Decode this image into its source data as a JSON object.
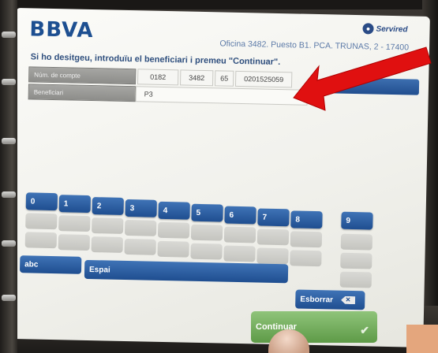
{
  "header": {
    "logo": "BBVA",
    "network": "Servired",
    "office": "Oficina 3482. Puesto B1. PCA. TRUNAS, 2 - 17400"
  },
  "instruction": "Si ho desitgeu, introduïu el beneficiari i premeu \"Continuar\".",
  "account": {
    "label": "Núm. de compte",
    "entity": "0182",
    "office": "3482",
    "control": "65",
    "number": "0201525059"
  },
  "beneficiary": {
    "label": "Beneficiari",
    "value": "P3"
  },
  "keypad": {
    "digits": [
      "0",
      "1",
      "2",
      "3",
      "4",
      "5",
      "6",
      "7",
      "8",
      "9"
    ],
    "abc": "abc",
    "space": "Espai",
    "delete": "Esborrar"
  },
  "continue_label": "Continuar",
  "colors": {
    "brand": "#1d4f91",
    "key_blue": "#2a5ea3",
    "continue_green": "#6fa95a",
    "arrow_red": "#e01010"
  }
}
